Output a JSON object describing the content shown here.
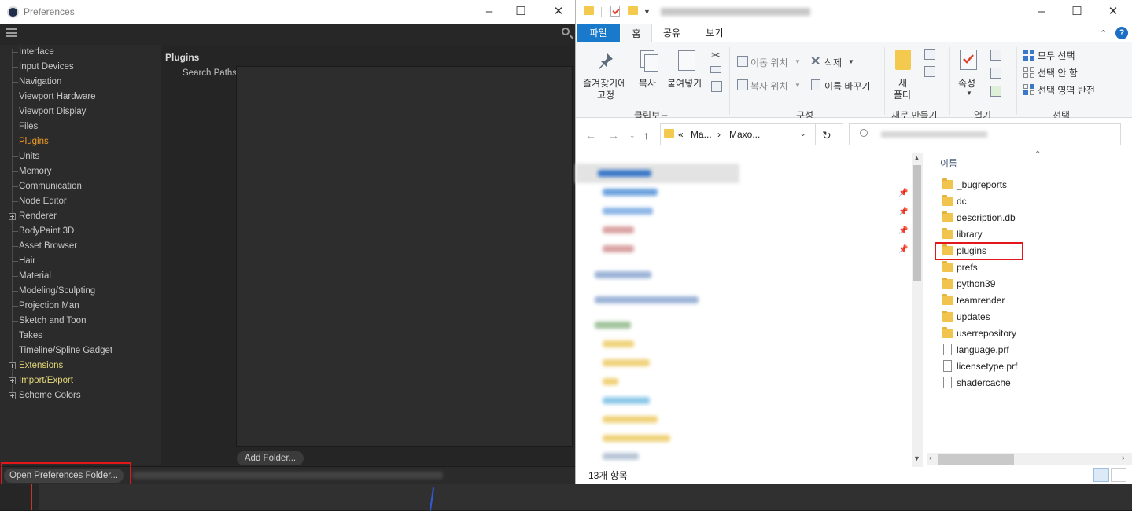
{
  "prefs": {
    "window_title": "Preferences",
    "tree": [
      {
        "label": "Interface",
        "style": "normal",
        "expander": false
      },
      {
        "label": "Input Devices",
        "style": "normal",
        "expander": false
      },
      {
        "label": "Navigation",
        "style": "normal",
        "expander": false
      },
      {
        "label": "Viewport Hardware",
        "style": "normal",
        "expander": false
      },
      {
        "label": "Viewport Display",
        "style": "normal",
        "expander": false
      },
      {
        "label": "Files",
        "style": "normal",
        "expander": false
      },
      {
        "label": "Plugins",
        "style": "active",
        "expander": false
      },
      {
        "label": "Units",
        "style": "normal",
        "expander": false
      },
      {
        "label": "Memory",
        "style": "normal",
        "expander": false
      },
      {
        "label": "Communication",
        "style": "normal",
        "expander": false
      },
      {
        "label": "Node Editor",
        "style": "normal",
        "expander": false
      },
      {
        "label": "Renderer",
        "style": "normal",
        "expander": true
      },
      {
        "label": "BodyPaint 3D",
        "style": "normal",
        "expander": false
      },
      {
        "label": "Asset Browser",
        "style": "normal",
        "expander": false
      },
      {
        "label": "Hair",
        "style": "normal",
        "expander": false
      },
      {
        "label": "Material",
        "style": "normal",
        "expander": false
      },
      {
        "label": "Modeling/Sculpting",
        "style": "normal",
        "expander": false
      },
      {
        "label": "Projection Man",
        "style": "normal",
        "expander": false
      },
      {
        "label": "Sketch and Toon",
        "style": "normal",
        "expander": false
      },
      {
        "label": "Takes",
        "style": "normal",
        "expander": false
      },
      {
        "label": "Timeline/Spline Gadget",
        "style": "normal",
        "expander": false
      },
      {
        "label": "Extensions",
        "style": "yellow",
        "expander": true
      },
      {
        "label": "Import/Export",
        "style": "yellow",
        "expander": true
      },
      {
        "label": "Scheme Colors",
        "style": "normal",
        "expander": true
      }
    ],
    "pane_title": "Plugins",
    "search_paths_label": "Search Paths",
    "add_folder_label": "Add Folder...",
    "open_prefs_label": "Open Preferences Folder..."
  },
  "explorer": {
    "tabs": {
      "file": "파일",
      "home": "홈",
      "share": "공유",
      "view": "보기"
    },
    "help": "?",
    "ribbon": {
      "pin_label_1": "즐겨찾기에",
      "pin_label_2": "고정",
      "copy": "복사",
      "paste": "붙여넣기",
      "clipboard_group": "클립보드",
      "move_to": "이동 위치",
      "copy_to": "복사 위치",
      "delete": "삭제",
      "rename": "이름 바꾸기",
      "organize_group": "구성",
      "new_folder_1": "새",
      "new_folder_2": "폴더",
      "new_group": "새로 만들기",
      "properties": "속성",
      "open_group": "열기",
      "select_all": "모두 선택",
      "select_none": "선택 안 함",
      "invert_selection": "선택 영역 반전",
      "select_group": "선택"
    },
    "address": {
      "prefix": "«",
      "crumb1": "Ma...",
      "sep": "›",
      "crumb2": "Maxo..."
    },
    "column_header": "이름",
    "files": [
      {
        "name": "_bugreports",
        "type": "folder"
      },
      {
        "name": "dc",
        "type": "folder"
      },
      {
        "name": "description.db",
        "type": "folder"
      },
      {
        "name": "library",
        "type": "folder"
      },
      {
        "name": "plugins",
        "type": "folder"
      },
      {
        "name": "prefs",
        "type": "folder"
      },
      {
        "name": "python39",
        "type": "folder"
      },
      {
        "name": "teamrender",
        "type": "folder"
      },
      {
        "name": "updates",
        "type": "folder"
      },
      {
        "name": "userrepository",
        "type": "folder"
      },
      {
        "name": "language.prf",
        "type": "file"
      },
      {
        "name": "licensetype.prf",
        "type": "file"
      },
      {
        "name": "shadercache",
        "type": "file"
      }
    ],
    "status": "13개 항목"
  },
  "colors": {
    "accent_orange": "#f39c24",
    "highlight_red": "#e3171b",
    "file_tab_blue": "#1979ca"
  }
}
